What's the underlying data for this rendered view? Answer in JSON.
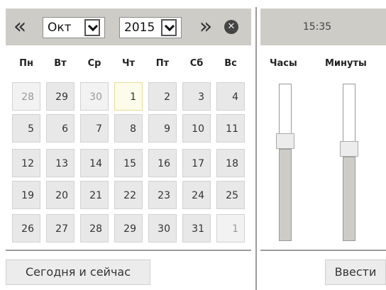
{
  "calendar": {
    "prev_label": "«",
    "next_label": "»",
    "close_label": "✕",
    "month": "Окт",
    "year": "2015",
    "weekdays": [
      "Пн",
      "Вт",
      "Ср",
      "Чт",
      "Пт",
      "Сб",
      "Вс"
    ],
    "weeks": [
      [
        "28",
        "29",
        "30",
        "1",
        "2",
        "3",
        "4"
      ],
      [
        "5",
        "6",
        "7",
        "8",
        "9",
        "10",
        "11"
      ],
      [
        "12",
        "13",
        "14",
        "15",
        "16",
        "17",
        "18"
      ],
      [
        "19",
        "20",
        "21",
        "22",
        "23",
        "24",
        "25"
      ],
      [
        "26",
        "27",
        "28",
        "29",
        "30",
        "31",
        "1"
      ]
    ],
    "today_label": "Сегодня и сейчас"
  },
  "time": {
    "display": "15:35",
    "hours_label": "Часы",
    "minutes_label": "Минуты",
    "hours_value": 15,
    "hours_max": 23,
    "minutes_value": 35,
    "minutes_max": 59,
    "apply_label": "Ввести"
  },
  "colors": {
    "header_bg": "#cdccc7",
    "day_bg": "#e8e8e8",
    "today_bg": "#fdfbe9"
  }
}
